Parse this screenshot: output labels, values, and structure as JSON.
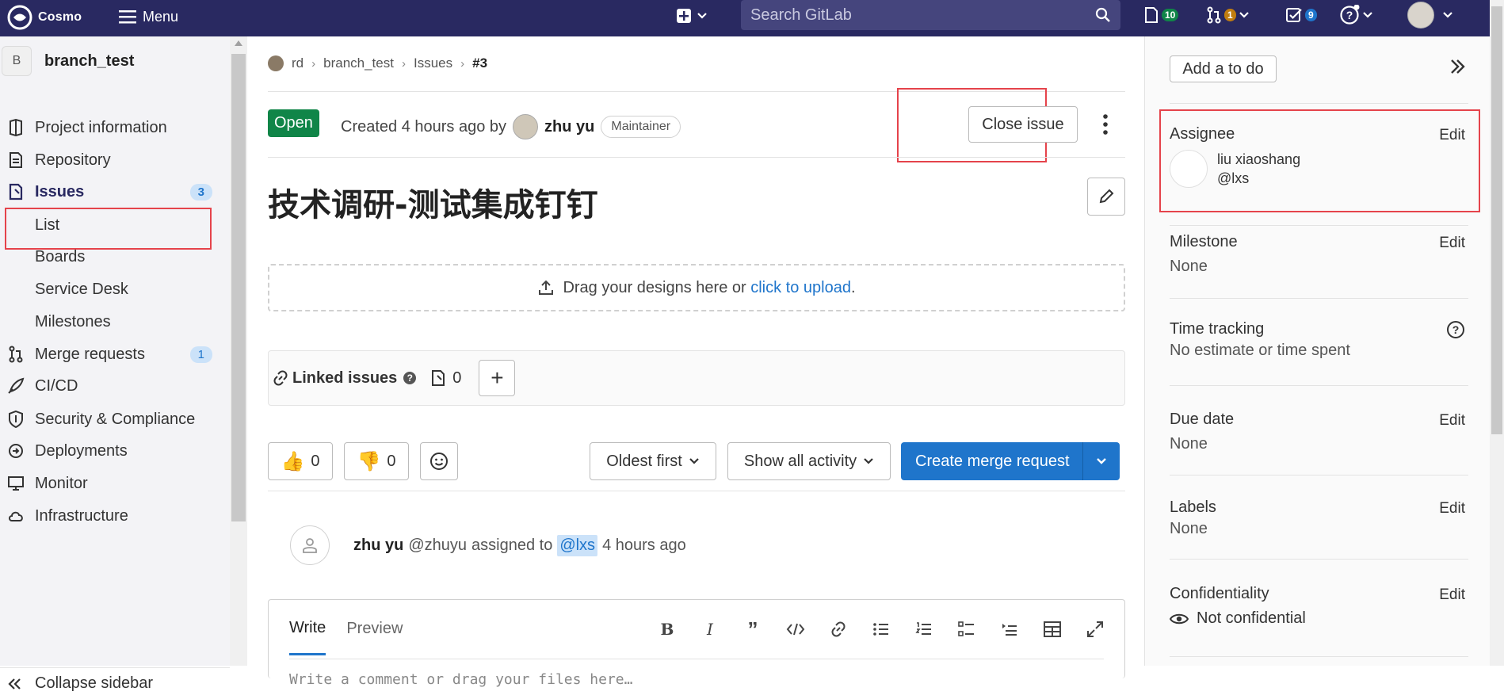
{
  "topbar": {
    "logo_text": "Cosmo",
    "menu_label": "Menu",
    "search_placeholder": "Search GitLab",
    "issues_count": "10",
    "merge_requests_count": "1",
    "todos_count": "9"
  },
  "sidebar": {
    "project_initial": "B",
    "project_name": "branch_test",
    "items": [
      {
        "label": "Project information",
        "icon": "info-icon"
      },
      {
        "label": "Repository",
        "icon": "doc-icon"
      },
      {
        "label": "Issues",
        "icon": "issues-icon",
        "count": "3"
      },
      {
        "label": "List"
      },
      {
        "label": "Boards"
      },
      {
        "label": "Service Desk"
      },
      {
        "label": "Milestones"
      },
      {
        "label": "Merge requests",
        "icon": "merge-request-icon",
        "count": "1"
      },
      {
        "label": "CI/CD",
        "icon": "rocket-icon"
      },
      {
        "label": "Security & Compliance",
        "icon": "shield-icon"
      },
      {
        "label": "Deployments",
        "icon": "deploy-icon"
      },
      {
        "label": "Monitor",
        "icon": "monitor-icon"
      },
      {
        "label": "Infrastructure",
        "icon": "cloud-icon"
      }
    ],
    "collapse_label": "Collapse sidebar"
  },
  "breadcrumb": {
    "group": "rd",
    "project": "branch_test",
    "section": "Issues",
    "current": "#3"
  },
  "issue": {
    "status": "Open",
    "created_text": "Created 4 hours ago by",
    "author": "zhu yu",
    "role": "Maintainer",
    "close_label": "Close issue",
    "title": "技术调研-测试集成钉钉",
    "drop_text": "Drag your designs here or",
    "drop_link": "click to upload",
    "drop_end": ".",
    "linked_label": "Linked issues",
    "linked_count": "0",
    "thumbs_up": "0",
    "thumbs_down": "0",
    "sort_label": "Oldest first",
    "filter_label": "Show all activity",
    "create_mr_label": "Create merge request"
  },
  "activity": {
    "author": "zhu yu",
    "handle": "@zhuyu",
    "action": "assigned to",
    "mention": "@lxs",
    "time": "4 hours ago"
  },
  "editor": {
    "tab_write": "Write",
    "tab_preview": "Preview",
    "placeholder": "Write a comment or drag your files here…"
  },
  "right_sidebar": {
    "todo_label": "Add a to do",
    "edit_label": "Edit",
    "assignee_head": "Assignee",
    "assignee_name": "liu xiaoshang",
    "assignee_handle": "@lxs",
    "milestone_head": "Milestone",
    "milestone_val": "None",
    "time_head": "Time tracking",
    "time_val": "No estimate or time spent",
    "due_head": "Due date",
    "due_val": "None",
    "labels_head": "Labels",
    "labels_val": "None",
    "conf_head": "Confidentiality",
    "conf_val": "Not confidential"
  },
  "colors": {
    "topbar": "#292961",
    "accent": "#1f75cb",
    "open_status": "#108548",
    "highlight_box": "#e5434b"
  }
}
